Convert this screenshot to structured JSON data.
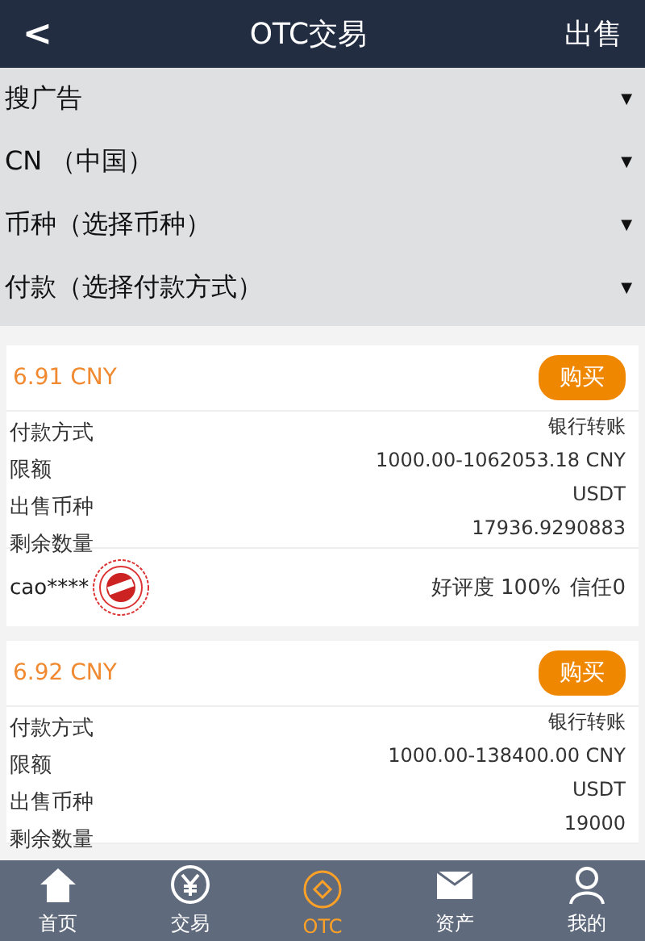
{
  "header": {
    "back": "<",
    "title": "OTC交易",
    "action": "出售"
  },
  "filters": [
    {
      "label": "搜广告",
      "caret": "▼"
    },
    {
      "label": "CN （中国）",
      "caret": "▼"
    },
    {
      "label": "币种（选择币种）",
      "caret": "▼"
    },
    {
      "label": "付款（选择付款方式）",
      "caret": "▼"
    }
  ],
  "offers": [
    {
      "price": "6.91 CNY",
      "button": "购买",
      "labels": [
        "付款方式",
        "限额",
        "出售币种",
        "剩余数量"
      ],
      "values": [
        "银行转账",
        "1000.00-1062053.18 CNY",
        "USDT",
        "17936.9290883"
      ],
      "user": "cao****",
      "rating": "好评度 100%",
      "trust": "信任0"
    },
    {
      "price": "6.92 CNY",
      "button": "购买",
      "labels": [
        "付款方式",
        "限额",
        "出售币种",
        "剩余数量"
      ],
      "values": [
        "银行转账",
        "1000.00-138400.00 CNY",
        "USDT",
        "19000"
      ]
    }
  ],
  "nav": [
    {
      "kind": "home",
      "label": "首页",
      "selected": false
    },
    {
      "kind": "trade",
      "label": "交易",
      "selected": false
    },
    {
      "kind": "otc",
      "label": "OTC",
      "selected": true
    },
    {
      "kind": "assets",
      "label": "资产",
      "selected": false
    },
    {
      "kind": "me",
      "label": "我的",
      "selected": false
    }
  ]
}
